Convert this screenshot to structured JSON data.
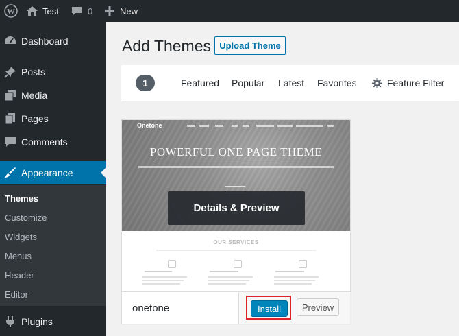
{
  "adminbar": {
    "site_name": "Test",
    "comments_count": "0",
    "new_label": "New"
  },
  "sidebar": {
    "items": [
      {
        "label": "Dashboard",
        "icon": "dashboard-icon"
      },
      {
        "label": "Posts",
        "icon": "pushpin-icon"
      },
      {
        "label": "Media",
        "icon": "media-icon"
      },
      {
        "label": "Pages",
        "icon": "pages-icon"
      },
      {
        "label": "Comments",
        "icon": "comment-icon"
      },
      {
        "label": "Appearance",
        "icon": "paintbrush-icon",
        "current": true
      },
      {
        "label": "Plugins",
        "icon": "plug-icon"
      }
    ],
    "submenu": [
      "Themes",
      "Customize",
      "Widgets",
      "Menus",
      "Header",
      "Editor"
    ]
  },
  "main": {
    "title": "Add Themes",
    "upload_label": "Upload Theme"
  },
  "filters": {
    "count": "1",
    "links": [
      "Featured",
      "Popular",
      "Latest",
      "Favorites"
    ],
    "feature_filter": "Feature Filter"
  },
  "theme": {
    "name": "onetone",
    "preview_logo": "Onetone",
    "preview_headline": "POWERFUL ONE PAGE THEME",
    "preview_services": "OUR SERVICES",
    "details_label": "Details & Preview",
    "install_label": "Install",
    "preview_label": "Preview"
  },
  "colors": {
    "admin_dark": "#23282d",
    "accent_blue": "#0073aa",
    "install_blue": "#0085ba",
    "highlight_red": "#e0232b"
  }
}
